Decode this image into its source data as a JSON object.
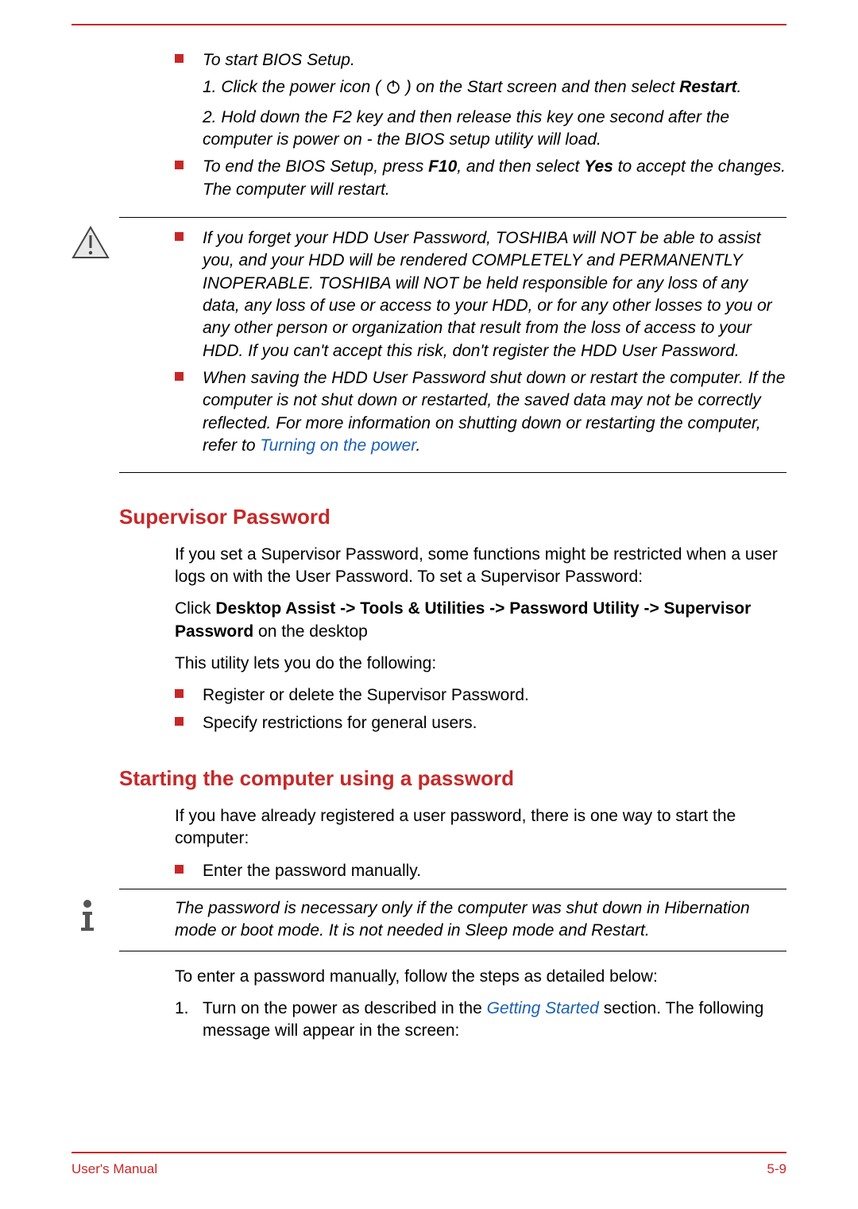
{
  "section1": {
    "b1": {
      "lead": "To start BIOS Setup.",
      "s1a": "1. Click the power icon (",
      "s1b": ") on the Start screen and then select ",
      "s1bold": "Restart",
      "s1c": ".",
      "s2": "2. Hold down the F2 key and then release this key one second after the computer is power on - the BIOS setup utility will load."
    },
    "b2a": "To end the BIOS Setup, press ",
    "b2bold1": "F10",
    "b2b": ", and then select ",
    "b2bold2": "Yes",
    "b2c": " to accept the changes. The computer will restart."
  },
  "warn": {
    "b1": "If you forget your HDD User Password, TOSHIBA will NOT be able to assist you, and your HDD will be rendered COMPLETELY and PERMANENTLY INOPERABLE. TOSHIBA will NOT be held responsible for any loss of any data, any loss of use or access to your HDD, or for any other losses to you or any other person or organization that result from the loss of access to your HDD. If you can't accept this risk, don't register the HDD User Password.",
    "b2a": "When saving the HDD User Password shut down or restart the computer. If the computer is not shut down or restarted, the saved data may not be correctly reflected. For more information on shutting down or restarting the computer, refer to ",
    "b2link": "Turning on the power",
    "b2b": "."
  },
  "sup": {
    "heading": "Supervisor Password",
    "p1": "If you set a Supervisor Password, some functions might be restricted when a user logs on with the User Password. To set a Supervisor Password:",
    "p2a": "Click ",
    "p2bold": "Desktop Assist -> Tools & Utilities -> Password Utility -> Supervisor Password",
    "p2b": " on the desktop",
    "p3": "This utility lets you do the following:",
    "l1": "Register or delete the Supervisor Password.",
    "l2": "Specify restrictions for general users."
  },
  "start": {
    "heading": "Starting the computer using a password",
    "p1": "If you have already registered a user password, there is one way to start the computer:",
    "l1": "Enter the password manually.",
    "note": "The password is necessary only if the computer was shut down in Hibernation mode or boot mode. It is not needed in Sleep mode and Restart.",
    "p2": "To enter a password manually, follow the steps as detailed below:",
    "o1a": "Turn on the power as described in the ",
    "o1link": "Getting Started",
    "o1b": " section. The following message will appear in the screen:"
  },
  "footer": {
    "left": "User's Manual",
    "right": "5-9"
  }
}
